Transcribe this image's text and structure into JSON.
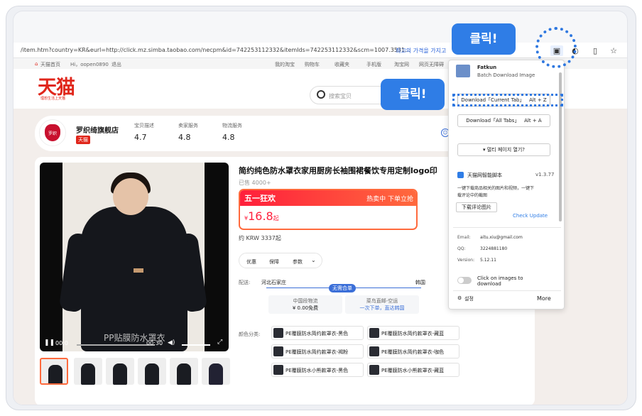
{
  "address_bar": {
    "url": "/item.htm?country=KR&eurl=http://click.mz.simba.taobao.com/necpm&id=742253112332&itemIds=742253112332&scm=1007.3531...",
    "translate_hint": "최고의 가격을 가지고"
  },
  "topbar": {
    "home": "天猫首页",
    "greeting": "Hi，oopen0890",
    "logout": "退出",
    "my_taobao": "我的淘宝",
    "cart": "购物车",
    "favorites": "收藏夹",
    "mobile": "手机版",
    "taobao": "淘宝网",
    "sitemap": "网页无障碍"
  },
  "header": {
    "logo": "天猫",
    "logo_sub": "理想生活上天猫",
    "search_placeholder": "搜索宝贝"
  },
  "shop": {
    "logo_text": "罗织",
    "name": "罗织绮旗舰店",
    "badge": "天猫",
    "stats": [
      {
        "label": "宝贝描述",
        "value": "4.7"
      },
      {
        "label": "卖家服务",
        "value": "4.8"
      },
      {
        "label": "物流服务",
        "value": "4.8"
      }
    ]
  },
  "product": {
    "title": "简约纯色防水罩衣家用厨房长袖围裙餐饮专用定制logo印",
    "sold": "已售 4000+",
    "promo": "五一狂欢",
    "promo_right": "热卖中 下单立抢",
    "price_symbol": "¥",
    "price": "16.8",
    "price_suffix": "起",
    "krw": "约 KRW 3337起",
    "pills": [
      "优惠",
      "保障",
      "参数"
    ],
    "video_caption": "PP贴膜防水罩衣",
    "video_time_start": "00:0",
    "video_time_end": "00:30"
  },
  "shipping": {
    "label": "配送:",
    "from": "河北石家庄",
    "to": "韩国",
    "badge": "无需合单",
    "left_title": "中国段物流",
    "left_value": "¥ 0.00免费",
    "right_title": "菜鸟直邮-空运",
    "right_value": "一次下单，直达韩国"
  },
  "options": {
    "label": "颜色分类:",
    "items": [
      "PE覆膜防水简约款罩衣-黑色",
      "PE覆膜防水简约款罩衣-藏蓝",
      "PE覆膜防水简约款罩衣-褐粉",
      "PE覆膜防水简约款罩衣-咖色",
      "PE覆膜防水小熊款罩衣-黑色",
      "PE覆膜防水小熊款罩衣-藏蓝"
    ]
  },
  "popup": {
    "app_name": "Fatkun",
    "app_sub": "Batch Download Image",
    "btn_current": "Download「Current Tab」",
    "btn_current_key": "Alt + Z",
    "btn_all": "Download「All Tabs」",
    "btn_all_key": "Alt + A",
    "multi_page": "▾ 멀티 페이지 열기?",
    "tmall_script": "天猫网智能脚本",
    "version_badge": "v1.3.77",
    "script_desc_1": "一键下载商品相关的图片和视频，一键下",
    "script_desc_2": "载评论中的截图",
    "download_comments": "下载评论图片",
    "check_update": "Check Update",
    "email_label": "Email:",
    "email": "aitu.xiu@gmail.com",
    "qq_label": "QQ:",
    "qq": "3224881180",
    "version_label": "Version:",
    "version": "5.12.11",
    "click_images": "Click on images to",
    "click_images_2": "download",
    "settings": "설정",
    "more": "More"
  },
  "callouts": [
    "클릭!",
    "클릭!"
  ],
  "colors": {
    "accent": "#2f7de6",
    "tmall_red": "#e0261b",
    "price_red": "#ff1f3c"
  }
}
